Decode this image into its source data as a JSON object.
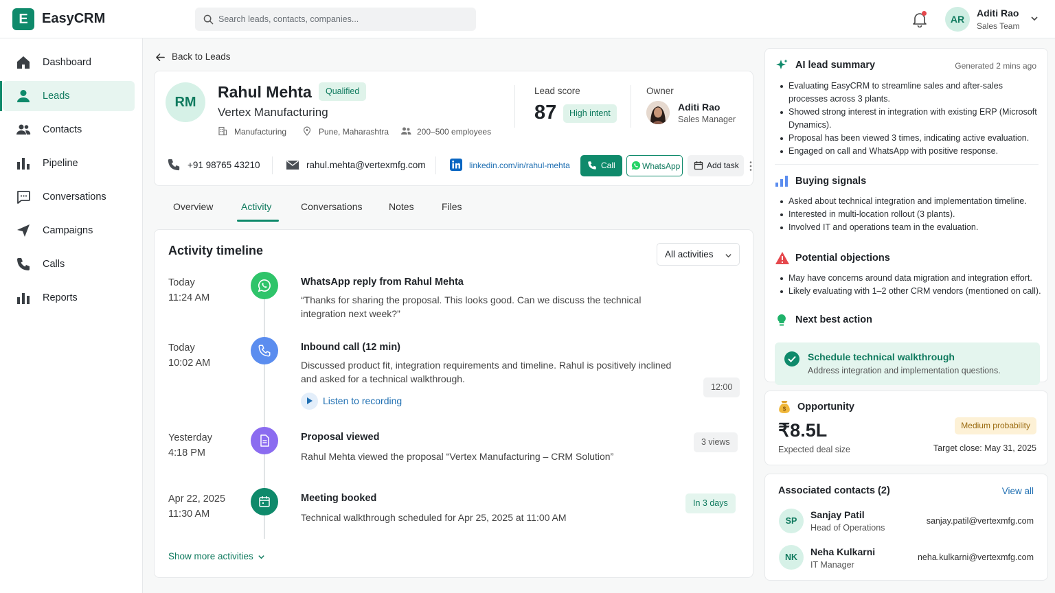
{
  "app": {
    "logo_letter": "E",
    "name": "EasyCRM"
  },
  "search": {
    "placeholder": "Search leads, contacts, companies..."
  },
  "user": {
    "initials": "AR",
    "name": "Aditi Rao",
    "team": "Sales Team"
  },
  "sidebar": {
    "items": [
      {
        "label": "Dashboard",
        "icon": "home-icon"
      },
      {
        "label": "Leads",
        "icon": "user-icon",
        "active": true
      },
      {
        "label": "Contacts",
        "icon": "contacts-icon"
      },
      {
        "label": "Pipeline",
        "icon": "pipeline-icon"
      },
      {
        "label": "Conversations",
        "icon": "chat-icon"
      },
      {
        "label": "Campaigns",
        "icon": "send-icon"
      },
      {
        "label": "Calls",
        "icon": "phone-icon"
      },
      {
        "label": "Reports",
        "icon": "reports-icon"
      }
    ]
  },
  "back_label": "Back to Leads",
  "lead": {
    "initials": "RM",
    "name": "Rahul Mehta",
    "status": "Qualified",
    "company": "Vertex Manufacturing",
    "industry": "Manufacturing",
    "location": "Pune, Maharashtra",
    "size": "200–500 employees",
    "score_label": "Lead score",
    "score": "87",
    "intent": "High intent",
    "owner_label": "Owner",
    "owner_name": "Aditi Rao",
    "owner_role": "Sales Manager",
    "phone": "+91 98765 43210",
    "email": "rahul.mehta@vertexmfg.com",
    "linkedin": "linkedin.com/in/rahul-mehta"
  },
  "actions": {
    "call": "Call",
    "whatsapp": "WhatsApp",
    "add_task": "Add task"
  },
  "tabs": [
    "Overview",
    "Activity",
    "Conversations",
    "Notes",
    "Files"
  ],
  "timeline": {
    "title": "Activity timeline",
    "filter": "All activities",
    "events": [
      {
        "day": "Today",
        "time": "11:24 AM",
        "title": "WhatsApp reply from Rahul Mehta",
        "desc": "“Thanks for sharing the proposal. This looks good. Can we discuss the technical integration next week?”",
        "icon": "whatsapp-icon"
      },
      {
        "day": "Today",
        "time": "10:02 AM",
        "title": "Inbound call (12 min)",
        "desc": "Discussed product fit, integration requirements and timeline. Rahul is positively inclined and asked for a technical walkthrough.",
        "link": "Listen to recording",
        "badge": "12:00",
        "icon": "phone-icon"
      },
      {
        "day": "Yesterday",
        "time": "4:18 PM",
        "title": "Proposal viewed",
        "desc": "Rahul Mehta viewed the proposal “Vertex Manufacturing – CRM Solution”",
        "badge": "3 views",
        "icon": "document-icon"
      },
      {
        "day": "Apr 22, 2025",
        "time": "11:30 AM",
        "title": "Meeting booked",
        "desc": "Technical walkthrough scheduled for Apr 25, 2025 at 11:00 AM",
        "badge": "In 3 days",
        "icon": "calendar-icon"
      }
    ],
    "show_more": "Show more activities"
  },
  "ai": {
    "title": "AI lead summary",
    "generated": "Generated 2 mins ago",
    "summary": [
      "Evaluating EasyCRM to streamline sales and after-sales processes across 3 plants.",
      "Showed strong interest in integration with existing ERP (Microsoft Dynamics).",
      "Proposal has been viewed 3 times, indicating active evaluation.",
      "Engaged on call and WhatsApp with positive response."
    ],
    "signals_title": "Buying signals",
    "signals": [
      "Asked about technical integration and implementation timeline.",
      "Interested in multi-location rollout (3 plants).",
      "Involved IT and operations team in the evaluation."
    ],
    "objections_title": "Potential objections",
    "objections": [
      "May have concerns around data migration and integration effort.",
      "Likely evaluating with 1–2 other CRM vendors (mentioned on call)."
    ],
    "nba_title": "Next best action",
    "nba_action": "Schedule technical walkthrough",
    "nba_desc": "Address integration and implementation questions."
  },
  "opportunity": {
    "title": "Opportunity",
    "probability": "Medium probability",
    "value": "₹8.5L",
    "value_label": "Expected deal size",
    "target_close": "Target close: May 31, 2025"
  },
  "associated": {
    "title": "Associated contacts (2)",
    "view_all": "View all",
    "contacts": [
      {
        "initials": "SP",
        "name": "Sanjay Patil",
        "role": "Head of Operations",
        "email": "sanjay.patil@vertexmfg.com"
      },
      {
        "initials": "NK",
        "name": "Neha Kulkarni",
        "role": "IT Manager",
        "email": "neha.kulkarni@vertexmfg.com"
      }
    ]
  },
  "colors": {
    "brand": "#0f8a6b",
    "brand_light": "#e7f5f0",
    "link": "#1f6fb2",
    "whatsapp": "#25d366",
    "call_icon": "#5b8def",
    "doc_icon": "#8b6cf0",
    "warning": "#e5484d"
  }
}
